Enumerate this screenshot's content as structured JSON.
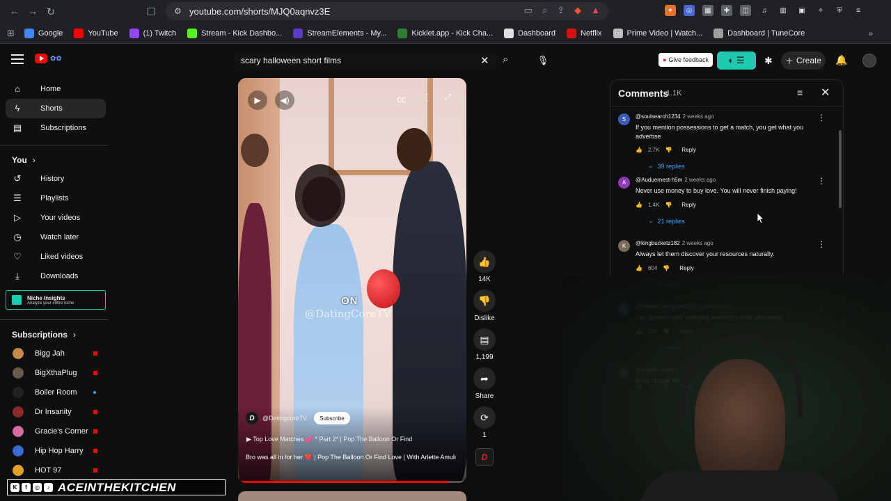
{
  "browser": {
    "url": "youtube.com/shorts/MJQ0aqnvz3E",
    "bookmarks": [
      {
        "label": "Google",
        "color": "#4285f4"
      },
      {
        "label": "YouTube",
        "color": "#ff0000"
      },
      {
        "label": "(1) Twitch",
        "color": "#9146ff"
      },
      {
        "label": "Stream - Kick Dashbo...",
        "color": "#53fc18"
      },
      {
        "label": "StreamElements - My...",
        "color": "#5b3cc4"
      },
      {
        "label": "Kicklet.app - Kick Cha...",
        "color": "#2e7d32"
      },
      {
        "label": "Dashboard",
        "color": "#e0e0e0"
      },
      {
        "label": "Netflix",
        "color": "#e50914"
      },
      {
        "label": "Prime Video | Watch...",
        "color": "#bdbdbd"
      },
      {
        "label": "Dashboard | TuneCore",
        "color": "#9e9e9e"
      }
    ]
  },
  "header": {
    "search_value": "scary halloween short films",
    "feedback_label": "Give feedback",
    "create_label": "Create"
  },
  "sidebar": {
    "main": [
      {
        "label": "Home",
        "icon": "⌂"
      },
      {
        "label": "Shorts",
        "icon": "ϟ"
      },
      {
        "label": "Subscriptions",
        "icon": "▤"
      }
    ],
    "you_label": "You",
    "you_items": [
      {
        "label": "History",
        "icon": "↺"
      },
      {
        "label": "Playlists",
        "icon": "☰"
      },
      {
        "label": "Your videos",
        "icon": "▷"
      },
      {
        "label": "Watch later",
        "icon": "◷"
      },
      {
        "label": "Liked videos",
        "icon": "♡"
      },
      {
        "label": "Downloads",
        "icon": "⤓"
      }
    ],
    "niche": {
      "title": "Niche Insights",
      "subtitle": "Analyze your entire niche"
    },
    "subscriptions_label": "Subscriptions",
    "subscriptions": [
      {
        "label": "Bigg Jah",
        "color": "#c78a4a"
      },
      {
        "label": "BigXthaPlug",
        "color": "#6a5a4a"
      },
      {
        "label": "Boiler Room",
        "color": "#222222"
      },
      {
        "label": "Dr Insanity",
        "color": "#8a2a2a"
      },
      {
        "label": "Gracie's Corner",
        "color": "#d46aa0"
      },
      {
        "label": "Hip Hop Harry",
        "color": "#3a6ad4"
      },
      {
        "label": "HOT 97",
        "color": "#e0a020"
      }
    ]
  },
  "video": {
    "on_badge": "ON",
    "watermark": "@DatingCoreTV",
    "channel": "@DatingcoreTV",
    "channel_initial": "D",
    "subscribe_label": "Subscribe",
    "playlist": "Top Love Matches 💕 * Part 2* | Pop The Balloon Or Find",
    "title": "Bro was all in for her ❤️ | Pop The Balloon Or Find Love | With Arlette Amuli",
    "progress": 0.92
  },
  "actions": {
    "likes": "14K",
    "dislike_label": "Dislike",
    "comments": "1,199",
    "share_label": "Share",
    "remix": "1"
  },
  "comments": {
    "title": "Comments",
    "count": "1.1K",
    "reply_label": "Reply",
    "items": [
      {
        "author": "@soulsearch1234",
        "time": "2 weeks ago",
        "text": "If you mention possessions to get a match,  you get what you advertise",
        "likes": "2.7K",
        "replies": "39 replies",
        "avatar": "S",
        "color": "#3b5bb5"
      },
      {
        "author": "@Auduernest-h5m",
        "time": "2 weeks ago",
        "text": "Never use money to buy love. You will never finish paying!",
        "likes": "1.4K",
        "replies": "21 replies",
        "avatar": "A",
        "color": "#8e3bb5"
      },
      {
        "author": "@kingbucketz182",
        "time": "2 weeks ago",
        "text": "Always let them discover your resources naturally.",
        "likes": "604",
        "replies": "8 replies",
        "avatar": "K",
        "color": "#7a6a5a"
      },
      {
        "author": "@cohendi-decipher4291",
        "time": "2 weeks ago",
        "text": "Her decision was definitely based on what she heard",
        "likes": "918",
        "replies": "9 replies",
        "avatar": "C",
        "color": "#4a6ab5"
      },
      {
        "author": "@dukedevinski",
        "time": "2",
        "text": "Bro's cruisin' for",
        "likes": "852",
        "replies": "",
        "avatar": "D",
        "color": "#555555"
      }
    ]
  },
  "overlay": {
    "brand": "ACEINTHEKITCHEN",
    "social": [
      "K",
      "f",
      "◎",
      "♪"
    ]
  }
}
